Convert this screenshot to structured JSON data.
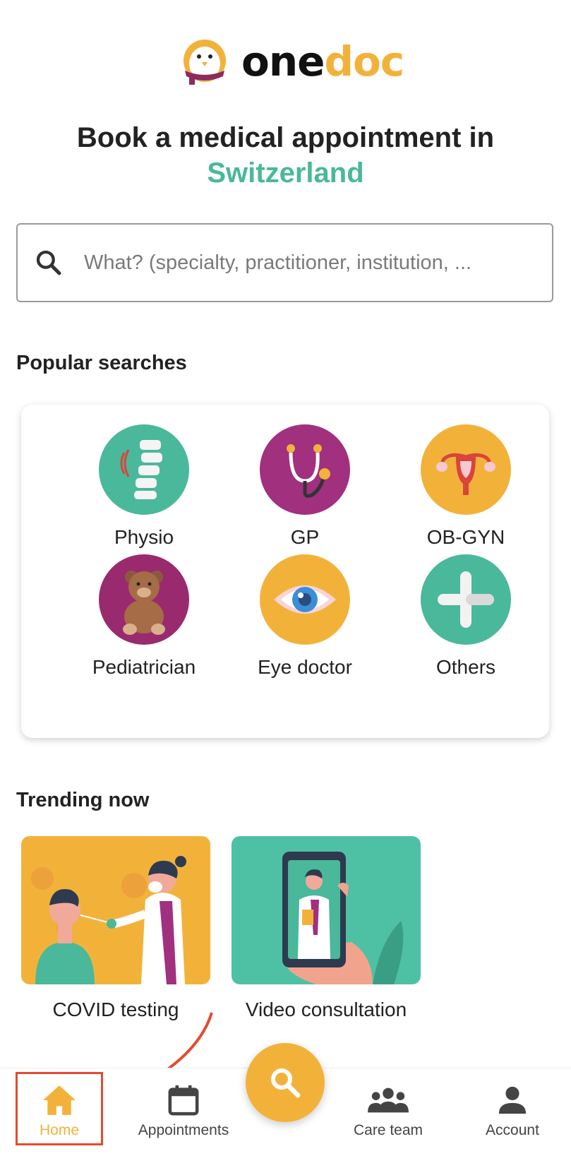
{
  "brand": {
    "name_part1": "one",
    "name_part2": "doc"
  },
  "headline": {
    "line1": "Book a medical appointment in",
    "country": "Switzerland"
  },
  "search": {
    "placeholder": "What? (specialty, practitioner, institution, ...",
    "icon": "search-icon"
  },
  "popular": {
    "title": "Popular searches",
    "items": [
      {
        "label": "Physio",
        "icon": "spine-icon",
        "color": "#4AB89A"
      },
      {
        "label": "GP",
        "icon": "stethoscope-icon",
        "color": "#A1307F"
      },
      {
        "label": "OB-GYN",
        "icon": "uterus-icon",
        "color": "#F2B23A"
      },
      {
        "label": "Pediatrician",
        "icon": "teddy-bear-icon",
        "color": "#9A2A6E"
      },
      {
        "label": "Eye doctor",
        "icon": "eye-icon",
        "color": "#F2B23A"
      },
      {
        "label": "Others",
        "icon": "plus-icon",
        "color": "#4AB89A"
      }
    ]
  },
  "trending": {
    "title": "Trending now",
    "items": [
      {
        "label": "COVID testing",
        "image": "covid-testing-illustration",
        "color": "#F2B23A"
      },
      {
        "label": "Video consultation",
        "image": "video-consultation-illustration",
        "color": "#4EC1A4"
      }
    ]
  },
  "nav": {
    "active": "Home",
    "active_color": "#F2B23A",
    "items": [
      {
        "label": "Home",
        "icon": "home-icon"
      },
      {
        "label": "Appointments",
        "icon": "calendar-icon"
      },
      {
        "label": "Care team",
        "icon": "people-icon"
      },
      {
        "label": "Account",
        "icon": "person-icon"
      }
    ],
    "fab_icon": "search-icon"
  }
}
